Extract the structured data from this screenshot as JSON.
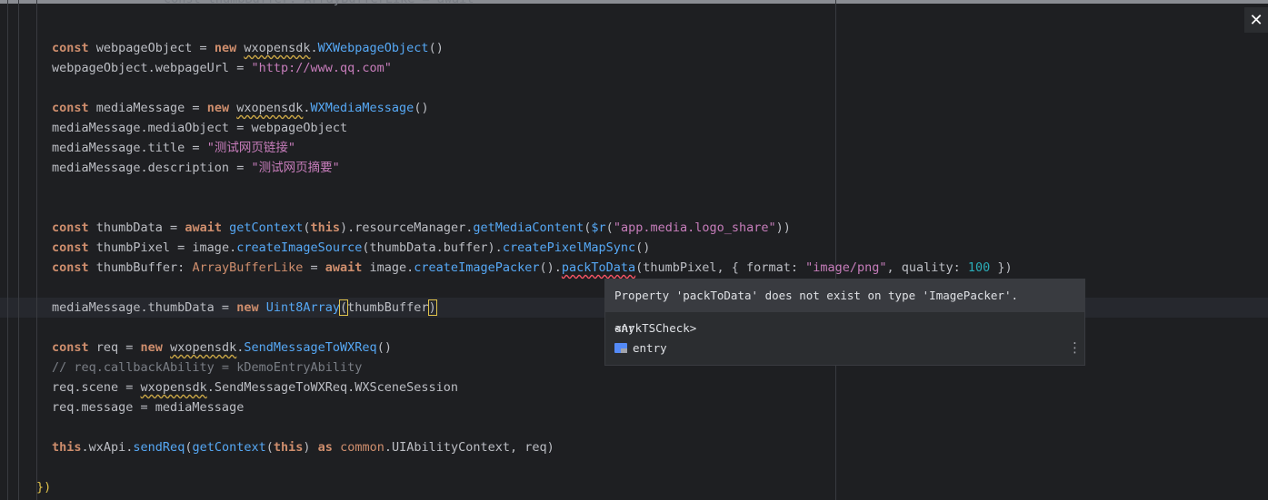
{
  "ui": {
    "close_label": "✕",
    "tooltip": {
      "message": "Property 'packToData' does not exist on type 'ImagePacker'. <ArkTSCheck>",
      "type_text": "any",
      "module_text": "entry",
      "menu_glyph": "⋮",
      "module_icon": "folder-module-icon"
    },
    "partial_top_line": "const thumbBuffer: ArrayBufferLike = await"
  },
  "code": {
    "l1": {
      "kw": "const",
      "v1": " webpageObject = ",
      "kw2": "new",
      "ns": "wxopensdk",
      "dot": ".",
      "cls": "WXWebpageObject",
      "p": "()"
    },
    "l2": {
      "a": "webpageObject.webpageUrl = ",
      "s": "\"http://www.qq.com\""
    },
    "l3": {
      "kw": "const",
      "v1": " mediaMessage = ",
      "kw2": "new",
      "ns": "wxopensdk",
      "dot": ".",
      "cls": "WXMediaMessage",
      "p": "()"
    },
    "l4": {
      "a": "mediaMessage.mediaObject = webpageObject"
    },
    "l5": {
      "a": "mediaMessage.title = ",
      "s": "\"测试网页链接\""
    },
    "l6": {
      "a": "mediaMessage.description = ",
      "s": "\"测试网页摘要\""
    },
    "l7": {
      "kw": "const",
      "a": " thumbData = ",
      "kw2": "await",
      "fn": "getContext",
      "p1": "(",
      "kw3": "this",
      "p2": ").resourceManager.",
      "fn2": "getMediaContent",
      "p3": "(",
      "fn3": "$r",
      "p4": "(",
      "s": "\"app.media.logo_share\"",
      "p5": "))"
    },
    "l8": {
      "kw": "const",
      "a": " thumbPixel = image.",
      "fn": "createImageSource",
      "p1": "(thumbData.buffer).",
      "fn2": "createPixelMapSync",
      "p2": "()"
    },
    "l9": {
      "kw": "const",
      "a": " thumbBuffer: ",
      "type": "ArrayBufferLike",
      "b": " = ",
      "kw2": "await",
      "c": " image.",
      "fn": "createImagePacker",
      "p1": "().",
      "fn2": "packToData",
      "p2": "(thumbPixel, { format: ",
      "s": "\"image/png\"",
      "p3": ", quality: ",
      "num": "100",
      "p4": " })"
    },
    "l10": {
      "a": "mediaMessage.thumbData = ",
      "kw": "new",
      "sp": " ",
      "fn": "Uint8Array",
      "p1": "(",
      "arg": "thumbBuffer",
      "p2": ")"
    },
    "l11": {
      "kw": "const",
      "a": " req = ",
      "kw2": "new",
      "sp": " ",
      "ns": "wxopensdk",
      "dot": ".",
      "cls": "SendMessageToWXReq",
      "p": "()"
    },
    "l12": {
      "c": "// req.callbackAbility = kDemoEntryAbility"
    },
    "l13": {
      "a": "req.scene = ",
      "ns": "wxopensdk",
      "b": ".SendMessageToWXReq.WXSceneSession"
    },
    "l14": {
      "a": "req.message = mediaMessage"
    },
    "l15": {
      "kw": "this",
      "a": ".wxApi.",
      "fn": "sendReq",
      "p1": "(",
      "fn2": "getContext",
      "p2": "(",
      "kw2": "this",
      "p3": ") ",
      "kw3": "as",
      "sp": " ",
      "type": "common",
      "p4": ".UIAbilityContext, req)"
    },
    "l16": {
      "a": "})"
    }
  },
  "colors": {
    "background": "#1e1f22",
    "keyword": "#cf8e6d",
    "function": "#56a8f5",
    "string": "#c77dbb",
    "number": "#2aacb8",
    "comment": "#7a7e85",
    "tooltip_bg": "#2b2d30",
    "tooltip_header_bg": "#393b40"
  }
}
